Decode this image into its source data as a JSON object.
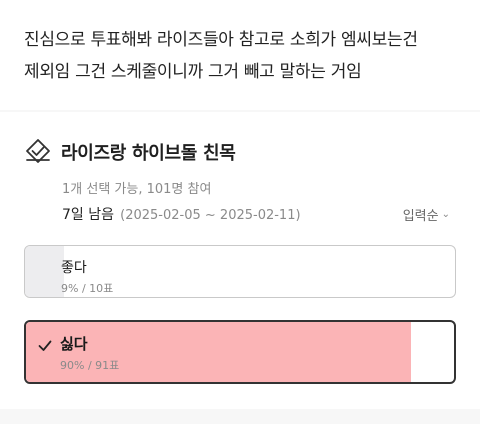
{
  "post": {
    "lines": [
      "진심으로 투표해봐 라이즈들아 참고로 소희가 엠씨보는건",
      "제외임 그건 스케줄이니까 그거 빼고 말하는 거임"
    ]
  },
  "poll": {
    "title": "라이즈랑 하이브돌 친목",
    "meta": "1개 선택 가능, 101명 참여",
    "remaining": "7일 남음",
    "date_range": "(2025-02-05 ~ 2025-02-11)",
    "sort_label": "입력순",
    "sort_icon": "chevron-down-icon",
    "title_icon": "vote-box-icon",
    "options": [
      {
        "label": "좋다",
        "count_text": "9% / 10표",
        "percent": 9,
        "selected": false,
        "fill_color": "#ededef"
      },
      {
        "label": "싫다",
        "count_text": "90% / 91표",
        "percent": 90,
        "selected": true,
        "fill_color": "#fbb4b6"
      }
    ]
  }
}
